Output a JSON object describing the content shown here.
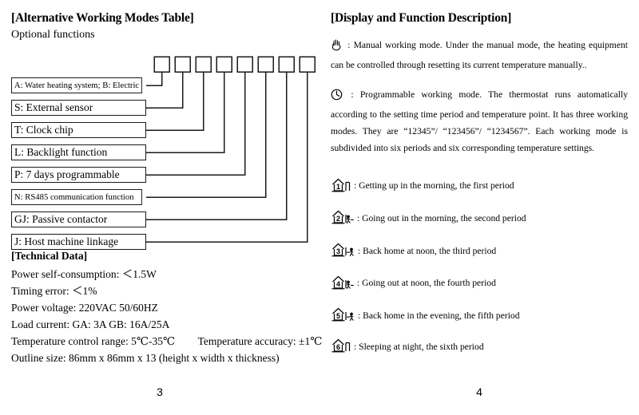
{
  "left_page": {
    "title": "[Alternative Working Modes Table]",
    "subtitle": "Optional functions",
    "option_labels": [
      "A: Water heating system; B: Electric heating system",
      "S: External sensor",
      "T: Clock chip",
      "L: Backlight function",
      "P: 7 days programmable",
      "N: RS485 communication function",
      "GJ: Passive contactor",
      "J: Host machine linkage"
    ],
    "technical_data": {
      "heading": "[Technical Data]",
      "items": [
        "Power self-consumption:  ＜1.5W",
        "Timing error:  ＜1%",
        "Power voltage: 220VAC 50/60HZ",
        "Load current: GA: 3A   GB: 16A/25A",
        "Outline size: 86mm x 86mm x 13 (height x width x thickness)"
      ],
      "temp_range": "Temperature control range: 5℃-35℃",
      "temp_accuracy": "Temperature accuracy:  ±1℃"
    },
    "page_number": "3"
  },
  "right_page": {
    "title": "[Display and Function Description]",
    "manual_mode": {
      "icon": "hand-icon",
      "text": ": Manual working mode. Under the manual mode, the heating equipment can be controlled through resetting its current temperature manually.."
    },
    "programmable_mode": {
      "icon": "clock-icon",
      "text": ": Programmable working mode. The thermostat runs automatically according to the setting time period and temperature point. It has three working modes. They are “12345”/ “123456”/ “1234567”. Each working mode is subdivided into six periods and six corresponding temperature settings."
    },
    "periods": [
      {
        "number": "1",
        "icon": "house-period-1-icon",
        "figure": "none",
        "text": ": Getting up in the morning, the first period"
      },
      {
        "number": "2",
        "icon": "house-period-2-icon",
        "figure": "leaving",
        "text": ": Going out in the morning, the second period"
      },
      {
        "number": "3",
        "icon": "house-period-3-icon",
        "figure": "entering",
        "text": ": Back home at noon, the third period"
      },
      {
        "number": "4",
        "icon": "house-period-4-icon",
        "figure": "leaving",
        "text": ": Going out at noon, the fourth period"
      },
      {
        "number": "5",
        "icon": "house-period-5-icon",
        "figure": "entering",
        "text": ": Back home in the evening, the fifth period"
      },
      {
        "number": "6",
        "icon": "house-period-6-icon",
        "figure": "none",
        "text": ": Sleeping at night, the sixth period"
      }
    ],
    "page_number": "4"
  },
  "colors": {
    "ink": "#000000",
    "line": "#1a1a1a",
    "paper": "#ffffff"
  }
}
